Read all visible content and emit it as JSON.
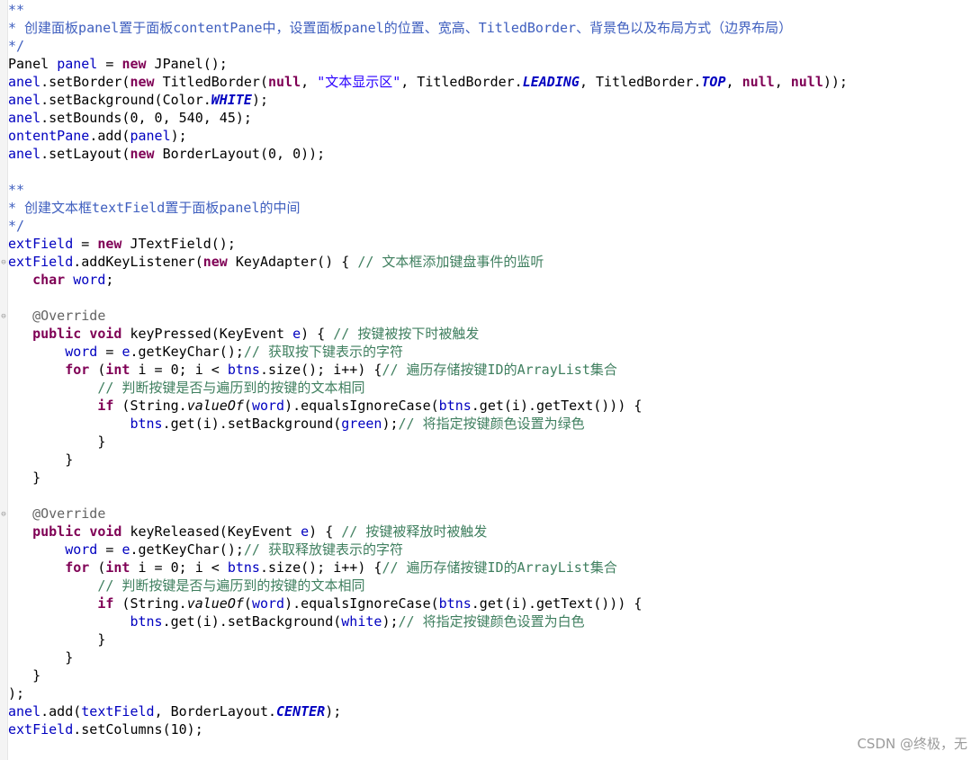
{
  "watermark": "CSDN @终极，无",
  "fold_glyph": "⊖",
  "lines": [
    [
      [
        "jd",
        "**"
      ]
    ],
    [
      [
        "jd",
        "* 创建面板panel置于面板contentPane中，设置面板panel的位置、宽高、TitledBorder、背景色以及布局方式（边界布局）"
      ]
    ],
    [
      [
        "jd",
        "*/"
      ]
    ],
    [
      [
        "t",
        "Panel "
      ],
      [
        "fld",
        "panel"
      ],
      [
        "t",
        " = "
      ],
      [
        "kw",
        "new"
      ],
      [
        "t",
        " JPanel();"
      ]
    ],
    [
      [
        "fld",
        "anel"
      ],
      [
        "t",
        ".setBorder("
      ],
      [
        "kw",
        "new"
      ],
      [
        "t",
        " TitledBorder("
      ],
      [
        "kw",
        "null"
      ],
      [
        "t",
        ", "
      ],
      [
        "str",
        "\"文本显示区\""
      ],
      [
        "t",
        ", TitledBorder."
      ],
      [
        "sfld",
        "LEADING"
      ],
      [
        "t",
        ", TitledBorder."
      ],
      [
        "sfld",
        "TOP"
      ],
      [
        "t",
        ", "
      ],
      [
        "kw",
        "null"
      ],
      [
        "t",
        ", "
      ],
      [
        "kw",
        "null"
      ],
      [
        "t",
        "));"
      ]
    ],
    [
      [
        "fld",
        "anel"
      ],
      [
        "t",
        ".setBackground(Color."
      ],
      [
        "sfld",
        "WHITE"
      ],
      [
        "t",
        ");"
      ]
    ],
    [
      [
        "fld",
        "anel"
      ],
      [
        "t",
        ".setBounds(0, 0, 540, 45);"
      ]
    ],
    [
      [
        "fld",
        "ontentPane"
      ],
      [
        "t",
        ".add("
      ],
      [
        "fld",
        "panel"
      ],
      [
        "t",
        ");"
      ]
    ],
    [
      [
        "fld",
        "anel"
      ],
      [
        "t",
        ".setLayout("
      ],
      [
        "kw",
        "new"
      ],
      [
        "t",
        " BorderLayout(0, 0));"
      ]
    ],
    [],
    [
      [
        "jd",
        "**"
      ]
    ],
    [
      [
        "jd",
        "* 创建文本框textField置于面板panel的中间"
      ]
    ],
    [
      [
        "jd",
        "*/"
      ]
    ],
    [
      [
        "fld",
        "extField"
      ],
      [
        "t",
        " = "
      ],
      [
        "kw",
        "new"
      ],
      [
        "t",
        " JTextField();"
      ]
    ],
    [
      [
        "fld",
        "extField"
      ],
      [
        "t",
        ".addKeyListener("
      ],
      [
        "kw",
        "new"
      ],
      [
        "t",
        " KeyAdapter() { "
      ],
      [
        "cm",
        "// 文本框添加键盘事件的监听"
      ]
    ],
    [
      [
        "t",
        "   "
      ],
      [
        "kw",
        "char"
      ],
      [
        "t",
        " "
      ],
      [
        "fld",
        "word"
      ],
      [
        "t",
        ";"
      ]
    ],
    [],
    [
      [
        "t",
        "   "
      ],
      [
        "ann",
        "@Override"
      ]
    ],
    [
      [
        "t",
        "   "
      ],
      [
        "kw",
        "public"
      ],
      [
        "t",
        " "
      ],
      [
        "kw",
        "void"
      ],
      [
        "t",
        " keyPressed(KeyEvent "
      ],
      [
        "fld",
        "e"
      ],
      [
        "t",
        ") { "
      ],
      [
        "cm",
        "// 按键被按下时被触发"
      ]
    ],
    [
      [
        "t",
        "       "
      ],
      [
        "fld",
        "word"
      ],
      [
        "t",
        " = "
      ],
      [
        "fld",
        "e"
      ],
      [
        "t",
        ".getKeyChar();"
      ],
      [
        "cm",
        "// 获取按下键表示的字符"
      ]
    ],
    [
      [
        "t",
        "       "
      ],
      [
        "kw",
        "for"
      ],
      [
        "t",
        " ("
      ],
      [
        "kw",
        "int"
      ],
      [
        "t",
        " i = 0; i < "
      ],
      [
        "fld",
        "btns"
      ],
      [
        "t",
        ".size(); i++) {"
      ],
      [
        "cm",
        "// 遍历存储按键ID的ArrayList集合"
      ]
    ],
    [
      [
        "t",
        "           "
      ],
      [
        "cm",
        "// 判断按键是否与遍历到的按键的文本相同"
      ]
    ],
    [
      [
        "t",
        "           "
      ],
      [
        "kw",
        "if"
      ],
      [
        "t",
        " (String."
      ],
      [
        "smeth",
        "valueOf"
      ],
      [
        "t",
        "("
      ],
      [
        "fld",
        "word"
      ],
      [
        "t",
        ").equalsIgnoreCase("
      ],
      [
        "fld",
        "btns"
      ],
      [
        "t",
        ".get(i).getText())) {"
      ]
    ],
    [
      [
        "t",
        "               "
      ],
      [
        "fld",
        "btns"
      ],
      [
        "t",
        ".get(i).setBackground("
      ],
      [
        "fld",
        "green"
      ],
      [
        "t",
        ");"
      ],
      [
        "cm",
        "// 将指定按键颜色设置为绿色"
      ]
    ],
    [
      [
        "t",
        "           }"
      ]
    ],
    [
      [
        "t",
        "       }"
      ]
    ],
    [
      [
        "t",
        "   }"
      ]
    ],
    [],
    [
      [
        "t",
        "   "
      ],
      [
        "ann",
        "@Override"
      ]
    ],
    [
      [
        "t",
        "   "
      ],
      [
        "kw",
        "public"
      ],
      [
        "t",
        " "
      ],
      [
        "kw",
        "void"
      ],
      [
        "t",
        " keyReleased(KeyEvent "
      ],
      [
        "fld",
        "e"
      ],
      [
        "t",
        ") { "
      ],
      [
        "cm",
        "// 按键被释放时被触发"
      ]
    ],
    [
      [
        "t",
        "       "
      ],
      [
        "fld",
        "word"
      ],
      [
        "t",
        " = "
      ],
      [
        "fld",
        "e"
      ],
      [
        "t",
        ".getKeyChar();"
      ],
      [
        "cm",
        "// 获取释放键表示的字符"
      ]
    ],
    [
      [
        "t",
        "       "
      ],
      [
        "kw",
        "for"
      ],
      [
        "t",
        " ("
      ],
      [
        "kw",
        "int"
      ],
      [
        "t",
        " i = 0; i < "
      ],
      [
        "fld",
        "btns"
      ],
      [
        "t",
        ".size(); i++) {"
      ],
      [
        "cm",
        "// 遍历存储按键ID的ArrayList集合"
      ]
    ],
    [
      [
        "t",
        "           "
      ],
      [
        "cm",
        "// 判断按键是否与遍历到的按键的文本相同"
      ]
    ],
    [
      [
        "t",
        "           "
      ],
      [
        "kw",
        "if"
      ],
      [
        "t",
        " (String."
      ],
      [
        "smeth",
        "valueOf"
      ],
      [
        "t",
        "("
      ],
      [
        "fld",
        "word"
      ],
      [
        "t",
        ").equalsIgnoreCase("
      ],
      [
        "fld",
        "btns"
      ],
      [
        "t",
        ".get(i).getText())) {"
      ]
    ],
    [
      [
        "t",
        "               "
      ],
      [
        "fld",
        "btns"
      ],
      [
        "t",
        ".get(i).setBackground("
      ],
      [
        "fld",
        "white"
      ],
      [
        "t",
        ");"
      ],
      [
        "cm",
        "// 将指定按键颜色设置为白色"
      ]
    ],
    [
      [
        "t",
        "           }"
      ]
    ],
    [
      [
        "t",
        "       }"
      ]
    ],
    [
      [
        "t",
        "   }"
      ]
    ],
    [
      [
        "t",
        ");"
      ]
    ],
    [
      [
        "fld",
        "anel"
      ],
      [
        "t",
        ".add("
      ],
      [
        "fld",
        "textField"
      ],
      [
        "t",
        ", BorderLayout."
      ],
      [
        "sfld",
        "CENTER"
      ],
      [
        "t",
        ");"
      ]
    ],
    [
      [
        "fld",
        "extField"
      ],
      [
        "t",
        ".setColumns(10);"
      ]
    ]
  ]
}
